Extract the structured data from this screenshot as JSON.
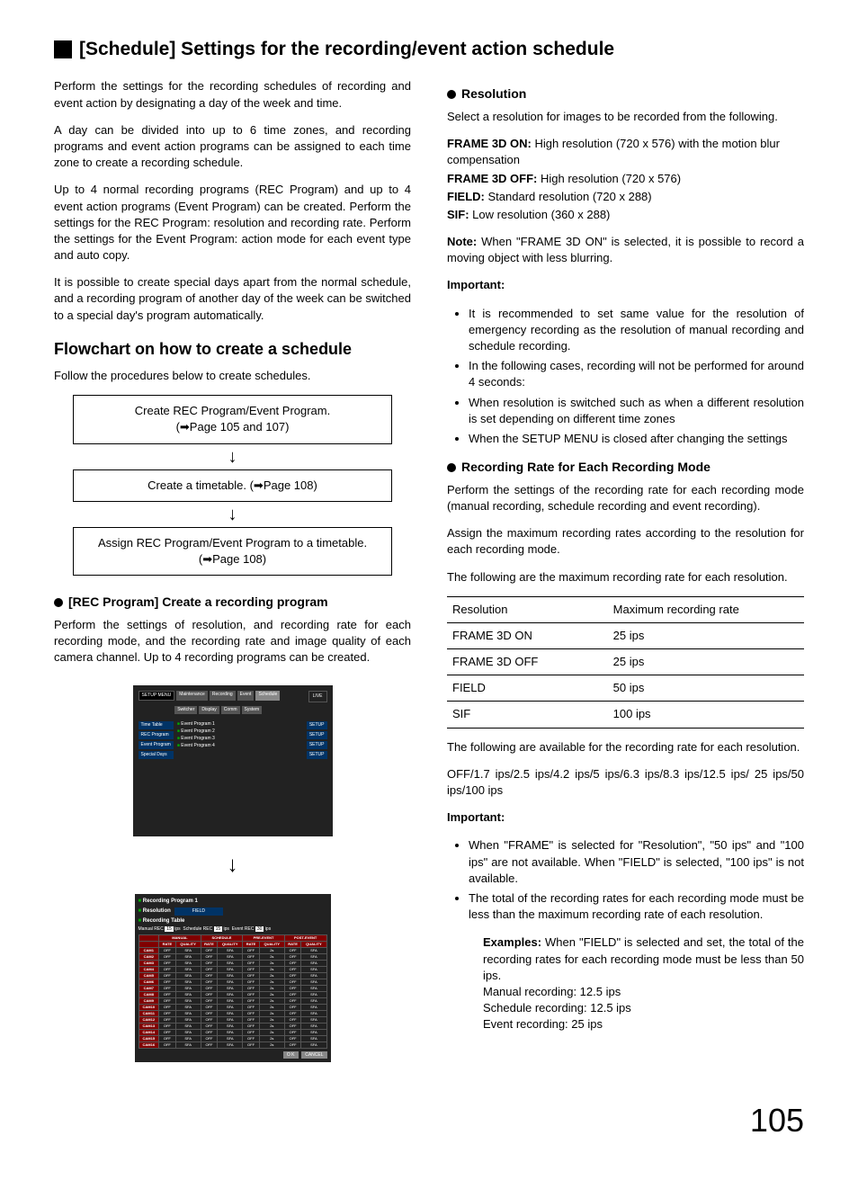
{
  "title": "[Schedule] Settings for the recording/event action schedule",
  "left": {
    "p1": "Perform the settings for the recording schedules of recording and event action by designating a day of the week and time.",
    "p2": "A day can be divided into up to 6 time zones, and recording programs and event action programs can be assigned to each time zone to create a recording schedule.",
    "p3": "Up to 4 normal recording programs (REC Program) and up to 4 event action programs (Event Program) can be created. Perform the settings for the REC Program: resolution and recording rate. Perform the settings for the Event Program: action mode for each event type and auto copy.",
    "p4": "It is possible to create special days apart from the normal schedule, and a recording program of another day of the week can be switched to a special day's program automatically.",
    "flow_title": "Flowchart on how to create a schedule",
    "flow_intro": "Follow the procedures below to create schedules.",
    "flow_box1a": "Create REC Program/Event Program.",
    "flow_box1b": "(➡Page 105 and 107)",
    "flow_box2": "Create a timetable. (➡Page 108)",
    "flow_box3a": "Assign REC Program/Event Program to a timetable.",
    "flow_box3b": "(➡Page 108)",
    "rec_title": "[REC Program] Create a recording program",
    "rec_p": "Perform the settings of resolution, and recording rate for each recording mode, and the recording rate and image quality of each camera channel. Up to 4 recording programs can be created.",
    "shot1": {
      "menu": "SETUP MENU",
      "tabs": [
        "Maintenance",
        "Recording",
        "Event",
        "Schedule",
        "System"
      ],
      "tabs2": [
        "Switcher",
        "Display",
        "Comm"
      ],
      "live": "LIVE",
      "side": [
        "Time Table",
        "REC Program",
        "Event Program",
        "Special Days"
      ],
      "items": [
        "Event Program 1",
        "Event Program 2",
        "Event Program 3",
        "Event Program 4"
      ],
      "setup": "SETUP"
    },
    "shot2": {
      "title": "Recording Program 1",
      "res_label": "Resolution",
      "res_value": "FIELD",
      "tbl_label": "Recording Table",
      "hdr_manual": "Manual REC",
      "hdr_sched": "Schedule REC",
      "hdr_event": "Event REC",
      "ips": "ips",
      "v15": "15",
      "v30": "30",
      "groups": [
        "MANUAL",
        "SCHEDULE",
        "PRE-EVENT",
        "POST-EVENT"
      ],
      "subcols": [
        "RATE",
        "QUALITY"
      ],
      "ok": "O K",
      "cancel": "CANCEL"
    }
  },
  "right": {
    "res_title": "Resolution",
    "res_p": "Select a resolution for images to be recorded from the following.",
    "res_items": [
      {
        "k": "FRAME 3D ON:",
        "v": " High resolution (720 x 576) with the motion blur compensation"
      },
      {
        "k": "FRAME 3D OFF:",
        "v": " High resolution (720 x 576)"
      },
      {
        "k": "FIELD:",
        "v": " Standard resolution (720 x 288)"
      },
      {
        "k": "SIF:",
        "v": " Low resolution (360 x 288)"
      }
    ],
    "note_label": "Note:",
    "note_text": " When \"FRAME 3D ON\" is selected, it is possible to record a moving object with less blurring.",
    "important1_label": "Important:",
    "important1_items": [
      "It is recommended to set same value for the resolution of emergency recording as the resolution of manual recording and schedule recording.",
      "In the following cases, recording will not be performed for around 4 seconds:",
      "When resolution is switched such as when a different resolution is set depending on different time zones",
      "When the SETUP MENU is closed after changing the settings"
    ],
    "rate_title": "Recording Rate for Each Recording Mode",
    "rate_p1": "Perform the settings of the recording rate for each recording mode (manual recording, schedule recording and event recording).",
    "rate_p2": "Assign the maximum recording rates according to the resolution for each recording mode.",
    "rate_p3": "The following are the maximum recording rate for each resolution.",
    "table_h1": "Resolution",
    "table_h2": "Maximum recording rate",
    "table_rows": [
      {
        "r": "FRAME 3D ON",
        "v": "25 ips"
      },
      {
        "r": "FRAME 3D OFF",
        "v": "25 ips"
      },
      {
        "r": "FIELD",
        "v": "50 ips"
      },
      {
        "r": "SIF",
        "v": "100 ips"
      }
    ],
    "rate_p4": "The following are available for the recording rate for each resolution.",
    "rate_p5": "OFF/1.7 ips/2.5 ips/4.2 ips/5 ips/6.3 ips/8.3 ips/12.5 ips/ 25 ips/50 ips/100 ips",
    "important2_label": "Important:",
    "important2_items": [
      "When \"FRAME\" is selected for \"Resolution\", \"50 ips\" and \"100 ips\" are not available. When \"FIELD\" is selected, \"100 ips\" is not available.",
      "The total of the recording rates for each recording mode must be less than the maximum recording rate of each resolution."
    ],
    "examples_label": "Examples:",
    "examples_text": " When \"FIELD\" is selected and set, the total of the recording rates for each recording mode must be less than 50 ips.",
    "examples_lines": [
      "Manual recording: 12.5 ips",
      "Schedule recording: 12.5 ips",
      "Event recording: 25 ips"
    ]
  },
  "page_number": "105"
}
